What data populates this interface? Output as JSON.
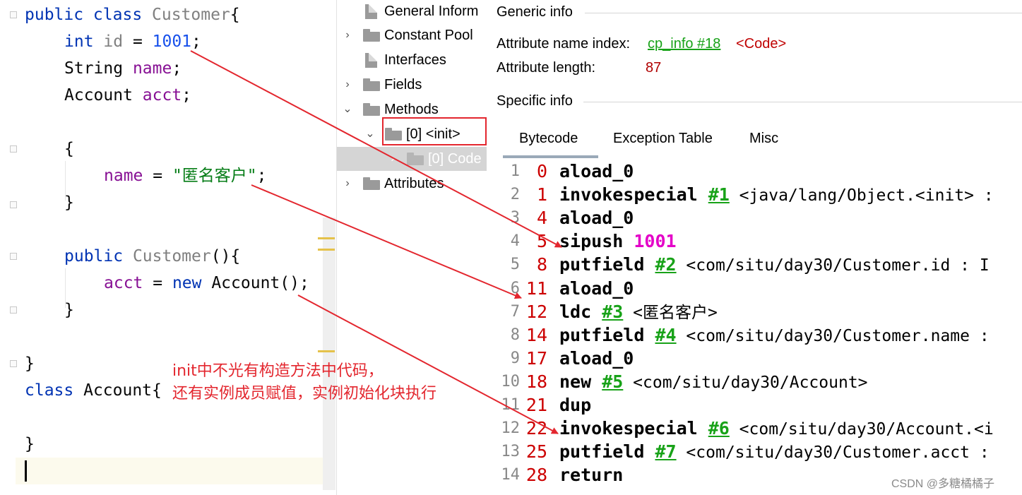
{
  "editor": {
    "lines": {
      "l1": {
        "kw": "public class ",
        "cls": "Customer",
        "rest": "{"
      },
      "l2": {
        "kw": "int ",
        "ident": "id",
        "eq": " = ",
        "num": "1001",
        "end": ";"
      },
      "l3": {
        "type": "String ",
        "fld": "name",
        "end": ";"
      },
      "l4": {
        "type": "Account ",
        "fld": "acct",
        "end": ";"
      },
      "l5": {
        "text": "{"
      },
      "l6": {
        "fld": "name",
        "eq": " = ",
        "str": "\"匿名客户\"",
        "end": ";"
      },
      "l7": {
        "text": "}"
      },
      "l8": {
        "kw": "public ",
        "cls": "Customer",
        "rest": "(){"
      },
      "l9": {
        "fld": "acct",
        "eq": " = ",
        "kw": "new ",
        "rest": "Account();"
      },
      "l10": {
        "text": "}"
      },
      "l11": {
        "text": "}"
      },
      "l12": {
        "kw": "class ",
        "rest": "Account{"
      },
      "l13": {
        "text": "}"
      }
    }
  },
  "tree": {
    "items": [
      {
        "label": "General Inform",
        "icon": "file-icon"
      },
      {
        "label": "Constant Pool",
        "icon": "folder-icon"
      },
      {
        "label": "Interfaces",
        "icon": "file-icon"
      },
      {
        "label": "Fields",
        "icon": "folder-icon"
      },
      {
        "label": "Methods",
        "icon": "folder-icon"
      },
      {
        "label": "[0] <init>",
        "icon": "folder-icon"
      },
      {
        "label": "[0] Code",
        "icon": "folder-icon"
      },
      {
        "label": "Attributes",
        "icon": "folder-icon"
      }
    ]
  },
  "panel": {
    "generic_title": "Generic info",
    "attr_name_label": "Attribute name index:",
    "attr_name_link": "cp_info #18",
    "attr_name_value": "<Code>",
    "attr_length_label": "Attribute length:",
    "attr_length_value": "87",
    "specific_title": "Specific info",
    "tabs": [
      "Bytecode",
      "Exception Table",
      "Misc"
    ]
  },
  "bytecode": [
    {
      "ln": "1",
      "off": "0",
      "ins": "aload_0",
      "ref": "",
      "arg": ""
    },
    {
      "ln": "2",
      "off": "1",
      "ins": "invokespecial ",
      "ref": "#1",
      "arg": " <java/lang/Object.<init> :"
    },
    {
      "ln": "3",
      "off": "4",
      "ins": "aload_0",
      "ref": "",
      "arg": ""
    },
    {
      "ln": "4",
      "off": "5",
      "ins": "sipush ",
      "ref": "",
      "arg": "",
      "num": "1001"
    },
    {
      "ln": "5",
      "off": "8",
      "ins": "putfield ",
      "ref": "#2",
      "arg": " <com/situ/day30/Customer.id : I"
    },
    {
      "ln": "6",
      "off": "11",
      "ins": "aload_0",
      "ref": "",
      "arg": ""
    },
    {
      "ln": "7",
      "off": "12",
      "ins": "ldc ",
      "ref": "#3",
      "arg": " <匿名客户>"
    },
    {
      "ln": "8",
      "off": "14",
      "ins": "putfield ",
      "ref": "#4",
      "arg": " <com/situ/day30/Customer.name :"
    },
    {
      "ln": "9",
      "off": "17",
      "ins": "aload_0",
      "ref": "",
      "arg": ""
    },
    {
      "ln": "10",
      "off": "18",
      "ins": "new ",
      "ref": "#5",
      "arg": " <com/situ/day30/Account>"
    },
    {
      "ln": "11",
      "off": "21",
      "ins": "dup",
      "ref": "",
      "arg": ""
    },
    {
      "ln": "12",
      "off": "22",
      "ins": "invokespecial ",
      "ref": "#6",
      "arg": " <com/situ/day30/Account.<i"
    },
    {
      "ln": "13",
      "off": "25",
      "ins": "putfield ",
      "ref": "#7",
      "arg": " <com/situ/day30/Customer.acct :"
    },
    {
      "ln": "14",
      "off": "28",
      "ins": "return",
      "ref": "",
      "arg": ""
    }
  ],
  "annotation": {
    "line1": "init中不光有构造方法中代码，",
    "line2": "还有实例成员赋值，实例初始化块执行",
    "color": "#e3262e"
  },
  "watermark": "CSDN @多糖橘橘子"
}
